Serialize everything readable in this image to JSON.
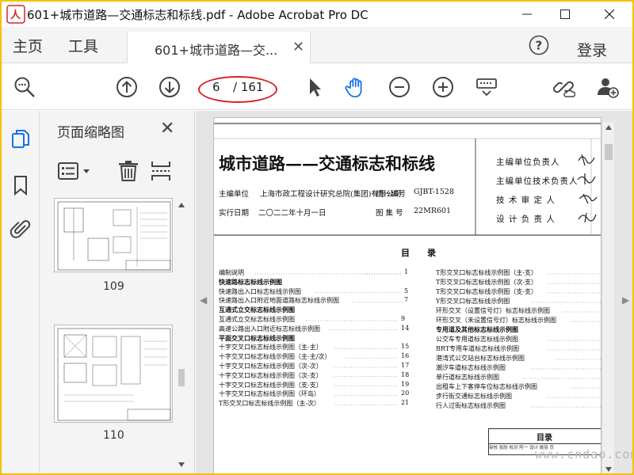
{
  "window": {
    "title": "601+城市道路—交通标志和标线.pdf - Adobe Acrobat Pro DC",
    "border_color": "#f2c300"
  },
  "menu": {
    "home": "主页",
    "tools": "工具",
    "doc_tab": "601+城市道路—交...",
    "login": "登录"
  },
  "toolbar": {
    "icons": [
      "search-zoom-icon",
      "page-up-icon",
      "page-down-icon",
      "select-arrow-icon",
      "hand-tool-icon",
      "zoom-out-icon",
      "zoom-in-icon",
      "keyboard-icon",
      "link-icon",
      "add-user-icon"
    ],
    "page_current": "6",
    "page_total": "/ 161",
    "highlight_color": "#d91f26"
  },
  "thumbnails": {
    "title": "页面缩略图",
    "items": [
      {
        "number": "109"
      },
      {
        "number": "110"
      }
    ]
  },
  "document": {
    "title": "城市道路——交通标志和标线",
    "editor_label": "主编单位",
    "editor": "上海市政工程设计研究总院(集团)有限公司",
    "code_label": "统一编号",
    "code": "GJBT-1528",
    "date_label": "实行日期",
    "date": "二〇二二年十月一日",
    "atlas_label": "图 集 号",
    "atlas_no": "22MR601",
    "roles": [
      "主编单位负责人",
      "主编单位技术负责人",
      "技 术 审 定 人",
      "设 计 负 责 人"
    ],
    "toc_heading": "目　　录",
    "toc_left": [
      {
        "text": "编制说明",
        "page": "1",
        "bold": false
      },
      {
        "text": "快速路标志标线示例图",
        "page": "",
        "bold": true
      },
      {
        "text": "快速路出入口标志标线示例图",
        "page": "5",
        "bold": false
      },
      {
        "text": "快速路出入口附近地面道路标志标线示例图",
        "page": "7",
        "bold": false
      },
      {
        "text": "互通式立交标志标线示例图",
        "page": "",
        "bold": true
      },
      {
        "text": "互通式立交标志标线示例图",
        "page": "9",
        "bold": false
      },
      {
        "text": "高速公路出入口附近标志标线示例图",
        "page": "14",
        "bold": false
      },
      {
        "text": "平面交叉口标志标线示例图",
        "page": "",
        "bold": true
      },
      {
        "text": "十字交叉口标志标线示例图（主-主）",
        "page": "15",
        "bold": false
      },
      {
        "text": "十字交叉口标志标线示例图（主-主/次）",
        "page": "16",
        "bold": false
      },
      {
        "text": "十字交叉口标志标线示例图（次-次）",
        "page": "17",
        "bold": false
      },
      {
        "text": "十字交叉口标志标线示例图（次-支）",
        "page": "18",
        "bold": false
      },
      {
        "text": "十字交叉口标志标线示例图（支-支）",
        "page": "19",
        "bold": false
      },
      {
        "text": "十字交叉口标志标线示例图（环岛）",
        "page": "20",
        "bold": false
      },
      {
        "text": "T形交叉口标志标线示例图（主-次）",
        "page": "21",
        "bold": false
      }
    ],
    "toc_right": [
      {
        "text": "T形交叉口标志标线示例图（主-支）",
        "bold": false
      },
      {
        "text": "T形交叉口标志标线示例图（次-支）",
        "bold": false
      },
      {
        "text": "T形交叉口标志标线示例图（支-支）",
        "bold": false
      },
      {
        "text": "Y形交叉口标志标线示例图",
        "bold": false
      },
      {
        "text": "环形交叉（设置信号灯）标志标线示例图",
        "bold": false
      },
      {
        "text": "环形交叉（未设置信号灯）标志标线示例图",
        "bold": false
      },
      {
        "text": "专用道及其他标志标线示例图",
        "bold": true
      },
      {
        "text": "公交车专用道标志标线示例图",
        "bold": false
      },
      {
        "text": "BRT专用车道标志标线示例图",
        "bold": false
      },
      {
        "text": "港湾式公交站台标志标线示例图",
        "bold": false
      },
      {
        "text": "潮汐车道标志标线示例图",
        "bold": false
      },
      {
        "text": "单行道标志标线示例图",
        "bold": false
      },
      {
        "text": "出租车上下客停车位标志标线示例图",
        "bold": false
      },
      {
        "text": "步行街交通标志标线示例图",
        "bold": false
      },
      {
        "text": "行人过街标志标线示例图",
        "bold": false
      }
    ],
    "footer_title": "目录",
    "footer_row": "审核 张耐 校对 阿一 设计 姚丽 页"
  },
  "watermark": "www.cndao.com"
}
